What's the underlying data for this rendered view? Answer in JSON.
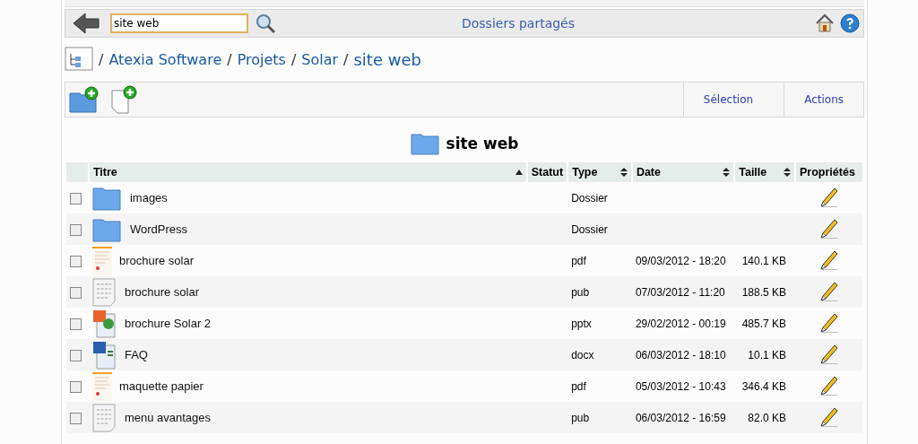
{
  "toolbar": {
    "search_value": "site web",
    "title": "Dossiers partagés"
  },
  "breadcrumb": {
    "links": [
      {
        "separator": "/",
        "label": "Atexia Software"
      },
      {
        "separator": "/",
        "label": "Projets"
      },
      {
        "separator": "/",
        "label": "Solar"
      }
    ],
    "current_separator": "/",
    "current": "site web"
  },
  "actions": [
    "Sélection",
    "Actions"
  ],
  "folder_title": "site web",
  "table": {
    "columns": [
      {
        "label": "Titre",
        "sortable": true,
        "sorted_ascending": true
      },
      {
        "label": "Statut",
        "sortable": false,
        "sorted_ascending": false
      },
      {
        "label": "Type",
        "sortable": true,
        "sorted_ascending": false
      },
      {
        "label": "Date",
        "sortable": true,
        "sorted_ascending": false
      },
      {
        "label": "Taille",
        "sortable": true,
        "sorted_ascending": false
      },
      {
        "label": "Propriétés",
        "sortable": false,
        "sorted_ascending": false
      }
    ],
    "rows": [
      {
        "kind": "folder",
        "title": "images",
        "type": "Dossier",
        "date": "",
        "size": "",
        "checked": false
      },
      {
        "kind": "folder",
        "title": "WordPress",
        "type": "Dossier",
        "date": "",
        "size": "",
        "checked": false
      },
      {
        "kind": "pdf",
        "title": "brochure solar",
        "type": "pdf",
        "date": "09/03/2012 - 18:20",
        "size": "140.1 KB",
        "checked": false
      },
      {
        "kind": "pub",
        "title": "brochure solar",
        "type": "pub",
        "date": "07/03/2012 - 11:20",
        "size": "188.5 KB",
        "checked": false
      },
      {
        "kind": "pptx",
        "title": "brochure Solar 2",
        "type": "pptx",
        "date": "29/02/2012 - 00:19",
        "size": "485.7 KB",
        "checked": false
      },
      {
        "kind": "docx",
        "title": "FAQ",
        "type": "docx",
        "date": "06/03/2012 - 18:10",
        "size": "10.1 KB",
        "checked": false
      },
      {
        "kind": "pdf",
        "title": "maquette papier",
        "type": "pdf",
        "date": "05/03/2012 - 10:43",
        "size": "346.4 KB",
        "checked": false
      },
      {
        "kind": "pub",
        "title": "menu avantages",
        "type": "pub",
        "date": "06/03/2012 - 16:59",
        "size": "82.0 KB",
        "checked": false
      }
    ]
  }
}
